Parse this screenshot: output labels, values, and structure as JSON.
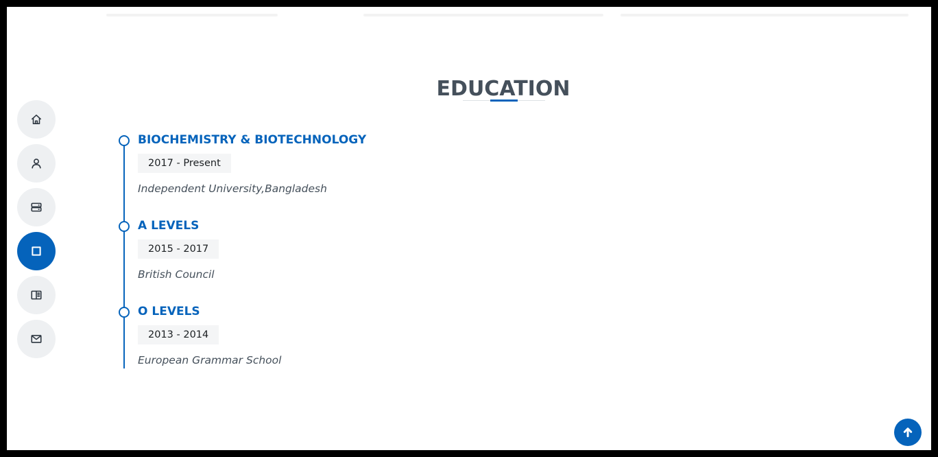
{
  "section": {
    "title": "EDUCATION"
  },
  "nav": {
    "items": [
      {
        "icon": "home-icon",
        "active": false
      },
      {
        "icon": "person-icon",
        "active": false
      },
      {
        "icon": "server-icon",
        "active": false
      },
      {
        "icon": "square-icon",
        "active": true
      },
      {
        "icon": "book-icon",
        "active": false
      },
      {
        "icon": "envelope-icon",
        "active": false
      }
    ]
  },
  "education": [
    {
      "title": "BIOCHEMISTRY & BIOTECHNOLOGY",
      "period": "2017 - Present",
      "place": "Independent University,Bangladesh"
    },
    {
      "title": "A LEVELS",
      "period": "2015 - 2017",
      "place": "British Council"
    },
    {
      "title": "O LEVELS",
      "period": "2013 - 2014",
      "place": "European Grammar School"
    }
  ],
  "colors": {
    "accent": "#0563bb",
    "heading": "#45505b",
    "nav_bg": "#eef0f2",
    "period_bg": "#f4f5f6"
  }
}
